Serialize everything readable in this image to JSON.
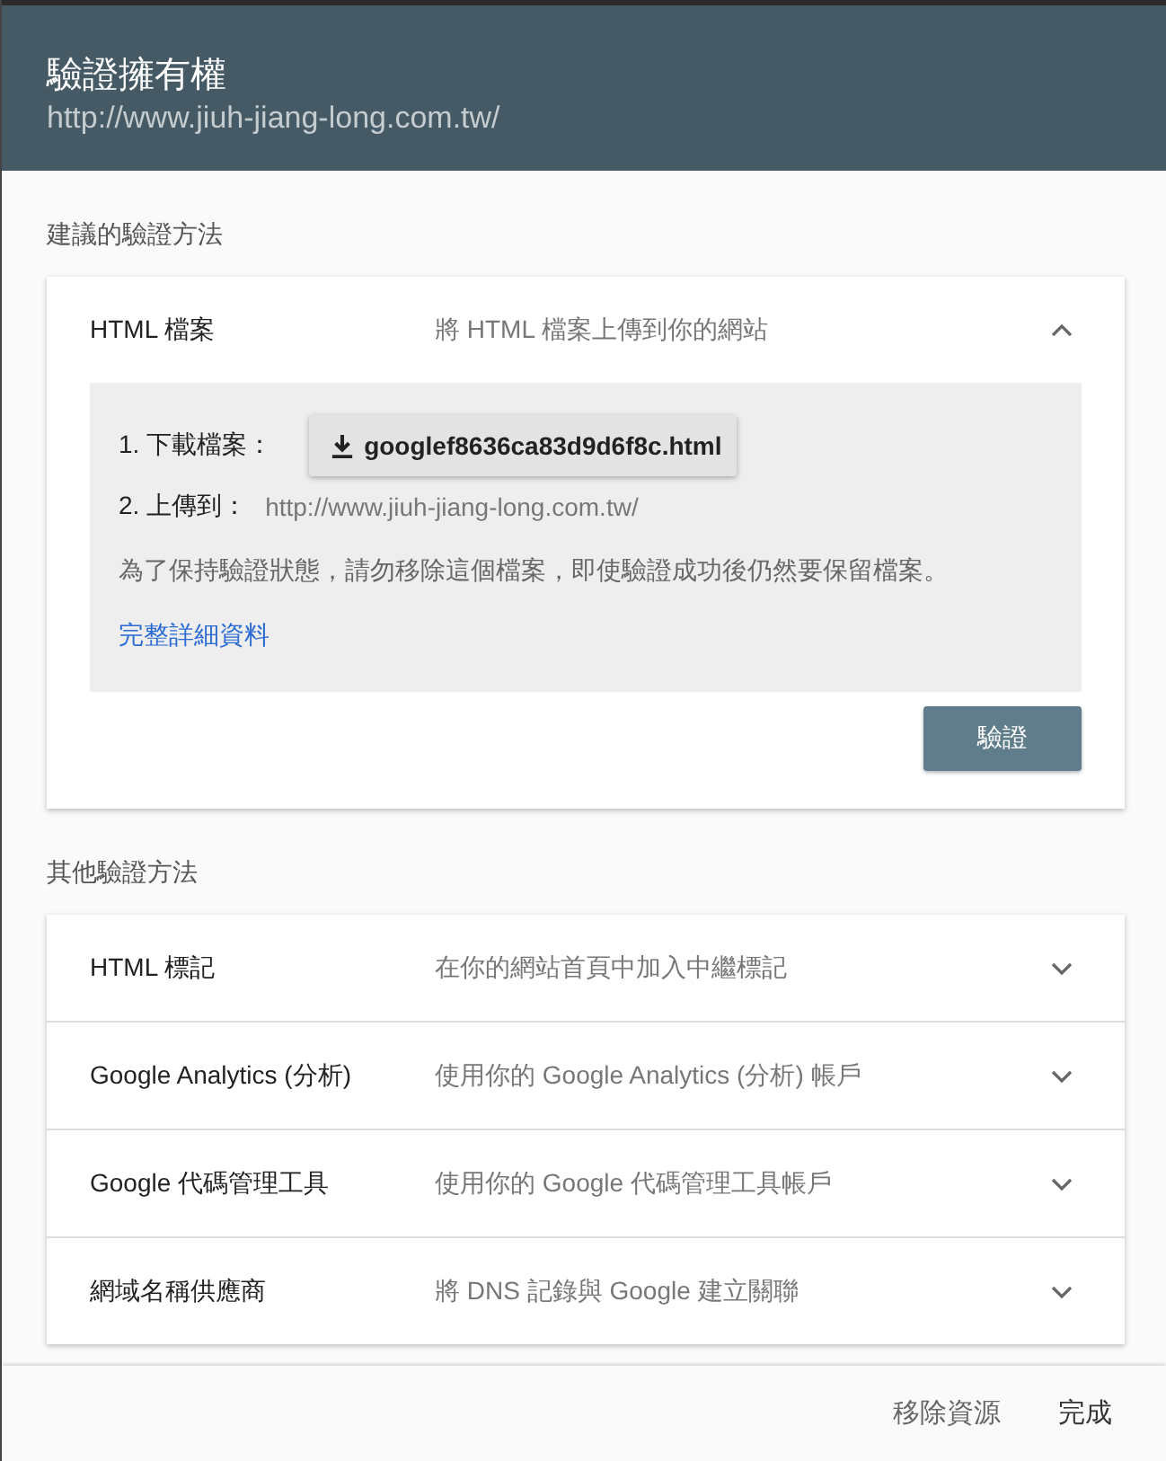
{
  "header": {
    "title": "驗證擁有權",
    "url": "http://www.jiuh-jiang-long.com.tw/"
  },
  "sections": [
    {
      "heading": "建議的驗證方法",
      "methods": [
        {
          "name": "HTML 檔案",
          "description": "將 HTML 檔案上傳到你的網站",
          "expanded": true,
          "details": {
            "step_1_label": "1. 下載檔案：",
            "download_file": "googlef8636ca83d9d6f8c.html",
            "step_2_label": "2. 上傳到：",
            "step_2_url": "http://www.jiuh-jiang-long.com.tw/",
            "note": "為了保持驗證狀態，請勿移除這個檔案，即使驗證成功後仍然要保留檔案。",
            "link": "完整詳細資料",
            "verify_button": "驗證"
          }
        }
      ]
    },
    {
      "heading": "其他驗證方法",
      "methods": [
        {
          "name": "HTML 標記",
          "description": "在你的網站首頁中加入中繼標記",
          "expanded": false
        },
        {
          "name": "Google Analytics (分析)",
          "description": "使用你的 Google Analytics (分析) 帳戶",
          "expanded": false
        },
        {
          "name": "Google 代碼管理工具",
          "description": "使用你的 Google 代碼管理工具帳戶",
          "expanded": false
        },
        {
          "name": "網域名稱供應商",
          "description": "將 DNS 記錄與 Google 建立關聯",
          "expanded": false
        }
      ]
    }
  ],
  "footer": {
    "buttons": [
      "移除資源",
      "完成"
    ]
  }
}
